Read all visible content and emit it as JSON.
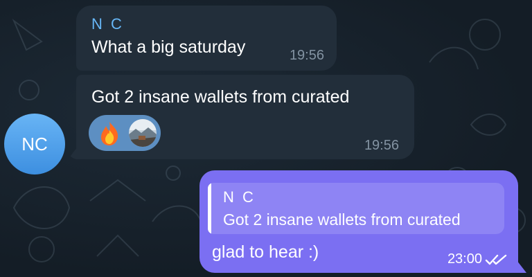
{
  "messages": [
    {
      "sender": "N C",
      "text": "What a big saturday",
      "time": "19:56"
    },
    {
      "text": "Got 2 insane wallets from curated",
      "time": "19:56",
      "reactions": [
        "fire-emoji",
        "user-avatar"
      ]
    }
  ],
  "avatar": {
    "initials": "NC"
  },
  "outgoing": {
    "quote_sender": "N C",
    "quote_text": "Got 2 insane wallets from curated",
    "text": "glad to hear :)",
    "time": "23:00",
    "status_icon": "double-check-icon"
  },
  "colors": {
    "incoming_bubble": "#222e3a",
    "outgoing_bubble": "#7b6ff2",
    "sender_name": "#67b7f7",
    "avatar": "#4a9be8"
  }
}
